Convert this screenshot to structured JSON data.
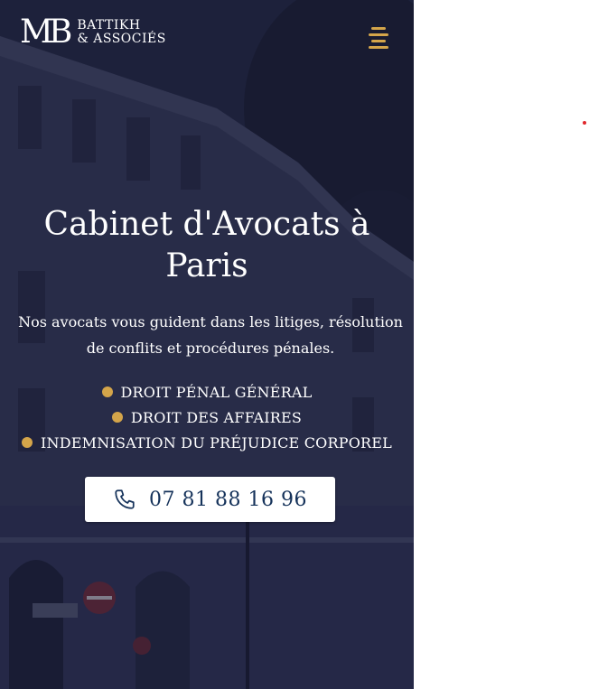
{
  "brand": {
    "monogram": "MB",
    "name_line1": "BATTIKH",
    "name_line2": "& ASSOCIÉS"
  },
  "header": {
    "menu_icon": "hamburger-menu-icon"
  },
  "hero": {
    "title": "Cabinet d'Avocats à Paris",
    "subtitle": "Nos avocats vous guident dans les litiges, résolution de conflits et procédures pénales.",
    "practice_areas": [
      "DROIT PÉNAL GÉNÉRAL",
      "DROIT DES AFFAIRES",
      "INDEMNISATION DU PRÉJUDICE CORPOREL"
    ],
    "phone": {
      "icon": "phone-icon",
      "number": "07 81 88 16 96"
    }
  },
  "colors": {
    "accent_gold": "#d4a54a",
    "phone_text": "#15325a",
    "overlay": "#1f2440"
  }
}
